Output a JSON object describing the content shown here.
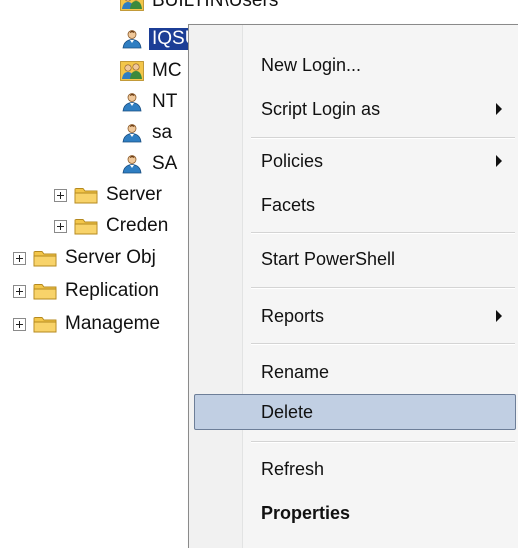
{
  "tree": {
    "items": [
      {
        "label": "BUILTIN\\Users",
        "icon": "users-group-icon"
      },
      {
        "label": "IQSUser",
        "icon": "user-icon",
        "selected": true
      },
      {
        "label": "MC",
        "icon": "users-group-icon"
      },
      {
        "label": "NT",
        "icon": "user-icon"
      },
      {
        "label": "sa",
        "icon": "user-icon"
      },
      {
        "label": "SA",
        "icon": "user-icon"
      },
      {
        "label": "Server",
        "icon": "folder-icon",
        "expandable": true
      },
      {
        "label": "Creden",
        "icon": "folder-icon",
        "expandable": true
      },
      {
        "label": "Server Obj",
        "icon": "folder-icon",
        "expandable": true
      },
      {
        "label": "Replication",
        "icon": "folder-icon",
        "expandable": true
      },
      {
        "label": "Manageme",
        "icon": "folder-icon",
        "expandable": true
      }
    ]
  },
  "context_menu": {
    "items": [
      {
        "label": "New Login...",
        "submenu": false
      },
      {
        "label": "Script Login as",
        "submenu": true
      },
      {
        "label": "Policies",
        "submenu": true
      },
      {
        "label": "Facets",
        "submenu": false
      },
      {
        "label": "Start PowerShell",
        "submenu": false
      },
      {
        "label": "Reports",
        "submenu": true
      },
      {
        "label": "Rename",
        "submenu": false
      },
      {
        "label": "Delete",
        "submenu": false,
        "highlighted": true
      },
      {
        "label": "Refresh",
        "submenu": false
      },
      {
        "label": "Properties",
        "submenu": false,
        "bold": true
      }
    ]
  },
  "colors": {
    "selection": "#1c3e96",
    "menu_highlight": "#c1cfe3",
    "folder": "#f3c64a"
  }
}
